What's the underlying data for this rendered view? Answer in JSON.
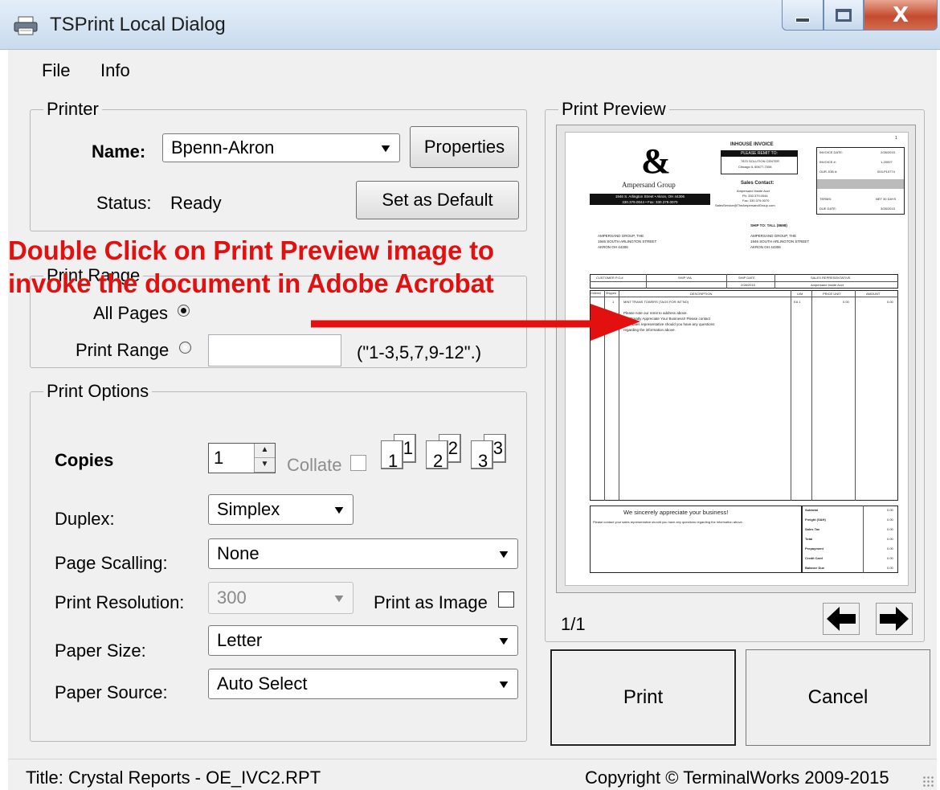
{
  "window": {
    "title": "TSPrint Local Dialog",
    "close_glyph": "X"
  },
  "menu": {
    "items": [
      "File",
      "Info"
    ]
  },
  "printer": {
    "group_title": "Printer",
    "name_label": "Name:",
    "name_value": "Bpenn-Akron",
    "properties_button": "Properties",
    "status_label": "Status:",
    "status_value": "Ready",
    "set_default_button": "Set as Default"
  },
  "print_range": {
    "group_title": "Print Range",
    "all_pages_label": "All Pages",
    "all_pages_selected": true,
    "print_range_label": "Print Range",
    "range_input_value": "",
    "range_hint": "(\"1-3,5,7,9-12\".)"
  },
  "print_options": {
    "group_title": "Print Options",
    "copies_label": "Copies",
    "copies_value": "1",
    "collate_label": "Collate",
    "collate_icons": [
      {
        "a": "1",
        "b": "1"
      },
      {
        "a": "2",
        "b": "2"
      },
      {
        "a": "3",
        "b": "3"
      }
    ],
    "duplex_label": "Duplex:",
    "duplex_value": "Simplex",
    "scaling_label": "Page Scalling:",
    "scaling_value": "None",
    "resolution_label": "Print Resolution:",
    "resolution_value": "300",
    "print_as_image_label": "Print as Image",
    "paper_size_label": "Paper Size:",
    "paper_size_value": "Letter",
    "paper_source_label": "Paper Source:",
    "paper_source_value": "Auto Select"
  },
  "preview": {
    "group_title": "Print Preview",
    "page_indicator": "1/1",
    "invoice": {
      "page_no": "1",
      "heading": "INHOUSE INVOICE",
      "remit_banner": "PLEASE REMIT TO:",
      "remit_lines": [
        "7870 SOLUTION CENTER",
        "Chicago  IL  60677-7008"
      ],
      "logo_mark": "&",
      "logo_text": "Ampersand Group",
      "company_bar": [
        "1946 S. Arlington Street • Akron, OH 44306",
        "330.379.0044 • Fax: 330.379.0070"
      ],
      "sales_contact_title": "Sales Contact:",
      "sales_contact_lines": [
        "Ampersand Inside Acct",
        "Ph: 330.379.0044",
        "Fax: 330.379.0070",
        "SalesService@TheAmpersandGroup.com"
      ],
      "meta": [
        [
          "INVOICE DATE:",
          "2/28/2015"
        ],
        [
          "INVOICE #:",
          "1-20007"
        ],
        [
          "OUR JOB #:",
          "003-P10774"
        ],
        [
          "TERMS:",
          "NET 30 DAYS"
        ],
        [
          "DUE DATE:",
          "3/28/2015"
        ]
      ],
      "bill_to": [
        "AMPERSAND GROUP, THE",
        "1946 SOUTH ARLINGTON STREET",
        "AKRON  OH  44306"
      ],
      "ship_to_title": "SHIP TO:  TALL (8698)",
      "ship_to": [
        "AMPERSAND GROUP, THE",
        "1946 SOUTH ARLINGTON STREET",
        "AKRON  OH  44306"
      ],
      "po_headers": [
        "CUSTOMER P.O.#",
        "SHIP VIA",
        "SHIP DATE",
        "SALES REPRESENTATIVE"
      ],
      "po_values": [
        "",
        "",
        "2/28/2015",
        "Ampersand Inside Acct"
      ],
      "line_headers": [
        "Ordered",
        "Shipped",
        "DESCRIPTION",
        "U/M",
        "PRICE UNIT",
        "AMOUNT"
      ],
      "line_item": [
        "",
        "1",
        "MINT TRANS TOWERS (TAGS FOR INT'NO)",
        "EA 1",
        "0.00",
        "0.00"
      ],
      "notes": [
        "Please note our remit to address above.",
        "We Greatly Appreciate Your Business!!  Please contact",
        "your sales representative should you have any questions",
        "regarding the information above."
      ],
      "footer_thanks": "We sincerely appreciate your business!",
      "footer_note": "Please contact your sales representative should you have any questions regarding the information above.",
      "totals": [
        [
          "Subtotal",
          "0.00"
        ],
        [
          "Freight (S&H)",
          "0.00"
        ],
        [
          "Sales Tax",
          "0.00"
        ],
        [
          "Total",
          "0.00"
        ],
        [
          "Prepayment",
          "0.00"
        ],
        [
          "Credit Card",
          "0.00"
        ],
        [
          "Balance Due",
          "0.00"
        ]
      ]
    }
  },
  "actions": {
    "print_button": "Print",
    "cancel_button": "Cancel"
  },
  "status_bar": {
    "title_text": "Title: Crystal Reports - OE_IVC2.RPT",
    "copyright_text": "Copyright © TerminalWorks 2009-2015"
  },
  "annotation": {
    "lines": [
      "Double Click on Print Preview image to",
      "invoke the document in Adobe Acrobat"
    ],
    "color": "#e31010"
  }
}
